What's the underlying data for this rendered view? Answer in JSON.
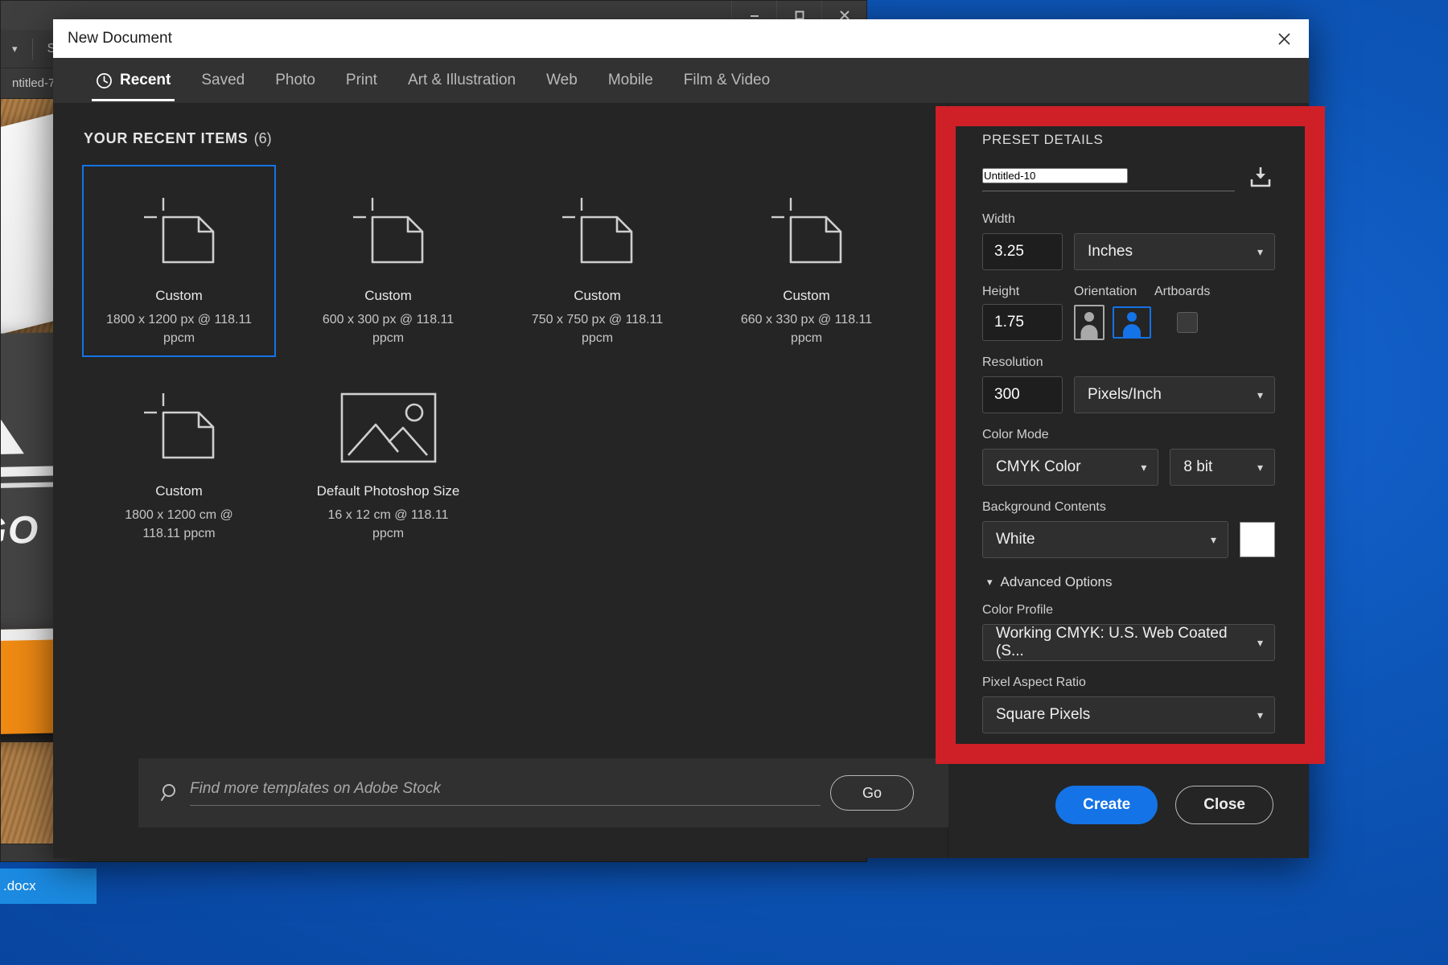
{
  "desktop": {
    "taskbar_item": ".docx"
  },
  "background_window": {
    "options_bar_text": "Smoo",
    "document_tab": "ntitled-7",
    "minimize_icon": "minimize-icon",
    "maximize_icon": "maximize-icon",
    "close_icon": "close-icon",
    "logo_mock_text": "LOGO"
  },
  "dialog": {
    "title": "New Document",
    "close_icon": "close-icon",
    "tabs": [
      {
        "label": "Recent",
        "icon": "clock-icon",
        "active": true
      },
      {
        "label": "Saved",
        "active": false
      },
      {
        "label": "Photo",
        "active": false
      },
      {
        "label": "Print",
        "active": false
      },
      {
        "label": "Art & Illustration",
        "active": false
      },
      {
        "label": "Web",
        "active": false
      },
      {
        "label": "Mobile",
        "active": false
      },
      {
        "label": "Film & Video",
        "active": false
      }
    ],
    "recent": {
      "heading": "YOUR RECENT ITEMS",
      "count": "(6)",
      "items": [
        {
          "name": "Custom",
          "dimensions": "1800 x 1200 px @ 118.11 ppcm",
          "icon": "document-icon",
          "selected": true
        },
        {
          "name": "Custom",
          "dimensions": "600 x 300 px @ 118.11 ppcm",
          "icon": "document-icon",
          "selected": false
        },
        {
          "name": "Custom",
          "dimensions": "750 x 750 px @ 118.11 ppcm",
          "icon": "document-icon",
          "selected": false
        },
        {
          "name": "Custom",
          "dimensions": "660 x 330 px @ 118.11 ppcm",
          "icon": "document-icon",
          "selected": false
        },
        {
          "name": "Custom",
          "dimensions": "1800 x 1200 cm @ 118.11 ppcm",
          "icon": "document-icon",
          "selected": false
        },
        {
          "name": "Default Photoshop Size",
          "dimensions": "16 x 12 cm @ 118.11 ppcm",
          "icon": "image-icon",
          "selected": false
        }
      ]
    },
    "search": {
      "icon": "search-icon",
      "placeholder": "Find more templates on Adobe Stock",
      "value": "",
      "go_label": "Go"
    },
    "preset_details": {
      "heading": "PRESET DETAILS",
      "name_value": "Untitled-10",
      "save_preset_icon": "save-preset-icon",
      "width_label": "Width",
      "width_value": "3.25",
      "width_unit": "Inches",
      "height_label": "Height",
      "height_value": "1.75",
      "orientation_label": "Orientation",
      "orientation_portrait_icon": "portrait-orientation-icon",
      "orientation_landscape_icon": "landscape-orientation-icon",
      "orientation_selected": "landscape",
      "artboards_label": "Artboards",
      "artboards_checked": false,
      "resolution_label": "Resolution",
      "resolution_value": "300",
      "resolution_unit": "Pixels/Inch",
      "color_mode_label": "Color Mode",
      "color_mode_value": "CMYK Color",
      "bit_depth_value": "8 bit",
      "background_label": "Background Contents",
      "background_value": "White",
      "background_swatch_color": "#ffffff",
      "advanced_label": "Advanced Options",
      "advanced_expanded": true,
      "color_profile_label": "Color Profile",
      "color_profile_value": "Working CMYK: U.S. Web Coated (S...",
      "pixel_aspect_label": "Pixel Aspect Ratio",
      "pixel_aspect_value": "Square Pixels"
    },
    "footer": {
      "create_label": "Create",
      "close_label": "Close"
    }
  },
  "annotation": {
    "highlight_color": "#cf2027",
    "target": "preset-details-panel"
  }
}
